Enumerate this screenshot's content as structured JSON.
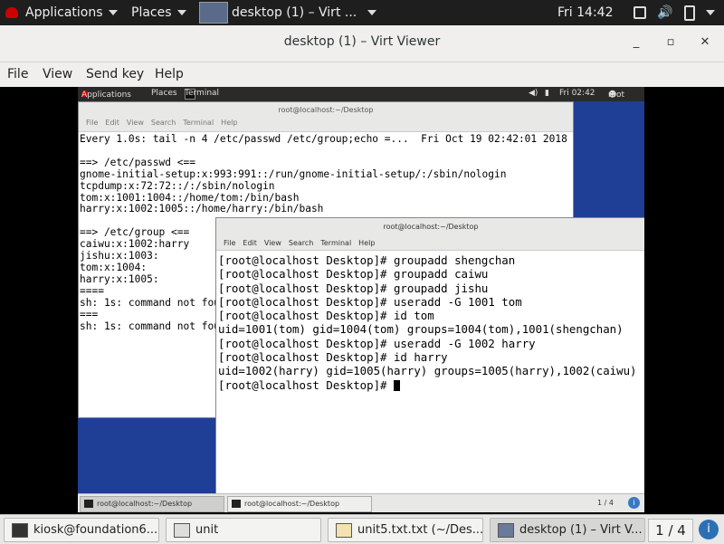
{
  "outer_topbar": {
    "applications": "Applications",
    "places": "Places",
    "active_window": "desktop (1) – Virt ...",
    "clock": "Fri 14:42"
  },
  "viewer": {
    "title": "desktop (1) – Virt Viewer",
    "menu": [
      "File",
      "View",
      "Send key",
      "Help"
    ]
  },
  "guest": {
    "topbar": {
      "applications": "Applications",
      "places": "Places",
      "terminal": "Terminal",
      "clock": "Fri 02:42",
      "user": "root"
    },
    "term_back": {
      "title": "root@localhost:~/Desktop",
      "menu": [
        "File",
        "Edit",
        "View",
        "Search",
        "Terminal",
        "Help"
      ],
      "lines": [
        "Every 1.0s: tail -n 4 /etc/passwd /etc/group;echo =...  Fri Oct 19 02:42:01 2018",
        "",
        "==> /etc/passwd <==",
        "gnome-initial-setup:x:993:991::/run/gnome-initial-setup/:/sbin/nologin",
        "tcpdump:x:72:72::/:/sbin/nologin",
        "tom:x:1001:1004::/home/tom:/bin/bash",
        "harry:x:1002:1005::/home/harry:/bin/bash",
        "",
        "==> /etc/group <==",
        "caiwu:x:1002:harry",
        "jishu:x:1003:",
        "tom:x:1004:",
        "harry:x:1005:",
        "====",
        "sh: 1s: command not fou",
        "===",
        "sh: 1s: command not fou"
      ]
    },
    "term_front": {
      "title": "root@localhost:~/Desktop",
      "menu": [
        "File",
        "Edit",
        "View",
        "Search",
        "Terminal",
        "Help"
      ],
      "lines": [
        "[root@localhost Desktop]# groupadd shengchan",
        "[root@localhost Desktop]# groupadd caiwu",
        "[root@localhost Desktop]# groupadd jishu",
        "[root@localhost Desktop]# useradd -G 1001 tom",
        "[root@localhost Desktop]# id tom",
        "uid=1001(tom) gid=1004(tom) groups=1004(tom),1001(shengchan)",
        "[root@localhost Desktop]# useradd -G 1002 harry",
        "[root@localhost Desktop]# id harry",
        "uid=1002(harry) gid=1005(harry) groups=1005(harry),1002(caiwu)",
        "[root@localhost Desktop]# "
      ]
    },
    "taskbar": {
      "task1": "root@localhost:~/Desktop",
      "task2": "root@localhost:~/Desktop",
      "pager": "1 / 4"
    }
  },
  "outer_taskbar": {
    "tasks": [
      "kiosk@foundation6...",
      "unit",
      "unit5.txt.txt (~/Des...",
      "desktop (1) – Virt V..."
    ],
    "pager": "1 / 4"
  },
  "colors": {
    "guest_desktop": "#1f3f96",
    "topbar": "#1e1e1e",
    "accent": "#2c6fb5"
  }
}
